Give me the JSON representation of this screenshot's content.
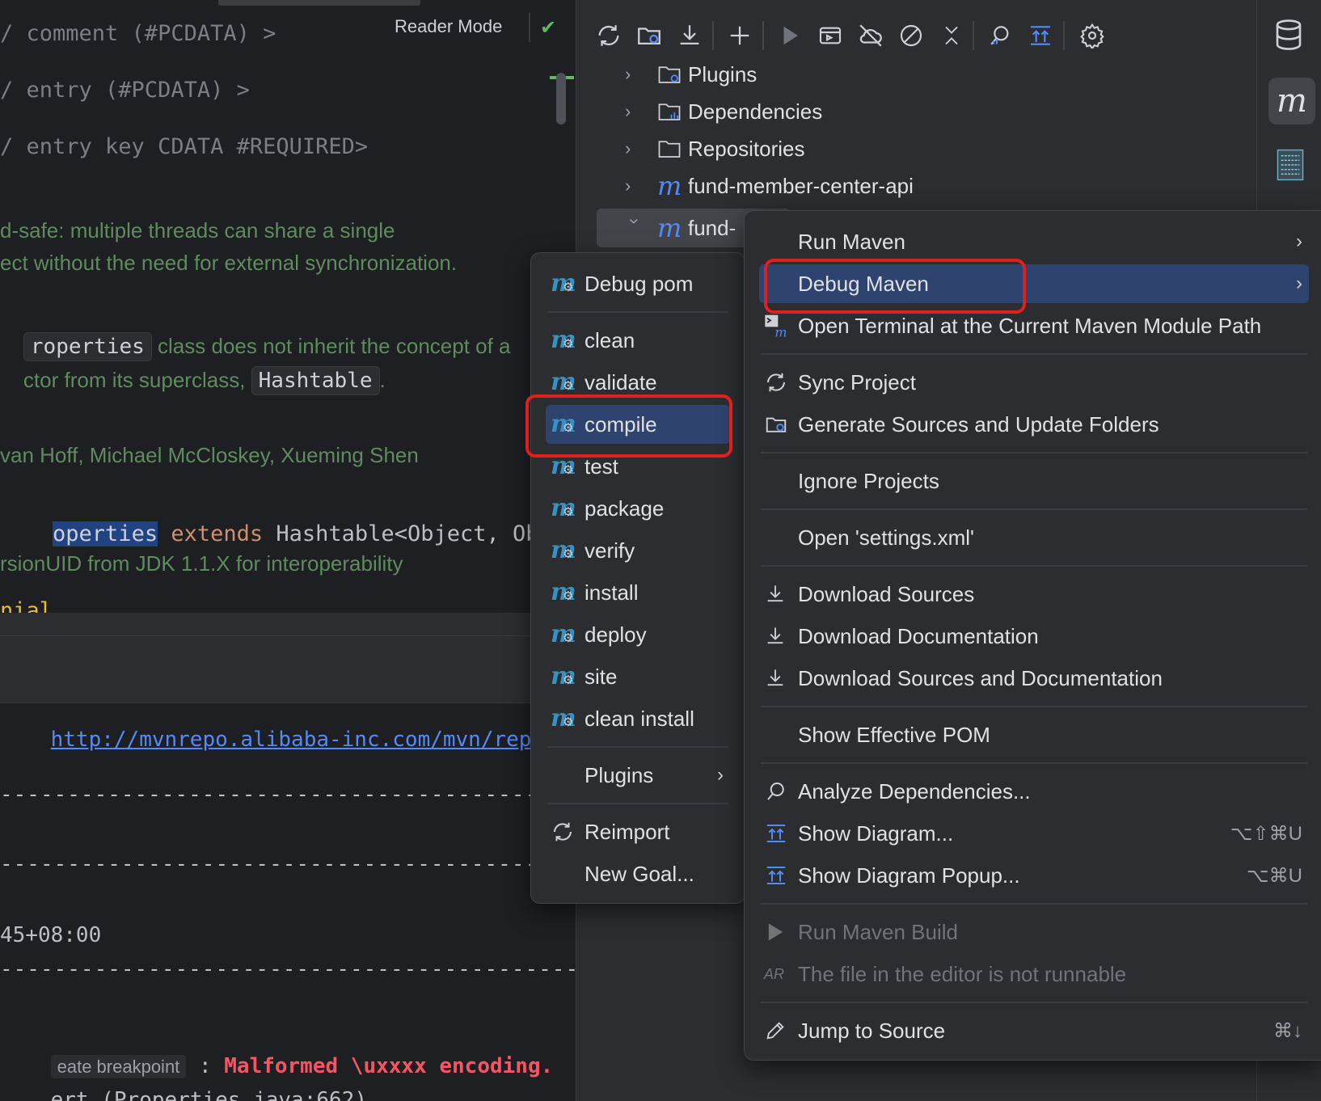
{
  "editor": {
    "reader_mode": "Reader Mode",
    "lines": {
      "l1": "/ comment (#PCDATA) >",
      "l2": "/ entry (#PCDATA) >",
      "l3": "/ entry key CDATA #REQUIRED>",
      "d1": "d-safe: multiple threads can share a single",
      "d2": "ect without the need for external synchronization.",
      "d3_chip": "roperties",
      "d3_rest": " class does not inherit the concept of a",
      "d4_a": "ctor from its superclass, ",
      "d4_chip": "Hashtable",
      "d4_b": ".",
      "d5": "van Hoff, Michael McCloskey, Xueming Shen",
      "c1_sel": "operties",
      "c1_kw": " extends",
      "c1_rest": " Hashtable",
      "c1_gen": "<Object, Object>",
      "d6": "rsionUID from JDK 1.1.X for interoperability",
      "c2": "nial"
    }
  },
  "console": {
    "url_line": "http://mvnrepo.alibaba-inc.com/mvn/reposito",
    "dash": "----------------------------------------------",
    "time": "45+08:00",
    "crumb": "eate breakpoint",
    "colon": " : ",
    "error": "Malformed \\uxxxx encoding.",
    "stack_pre": "ert (",
    "stack_link": "Properties.java:662",
    "stack_post": ")"
  },
  "maven": {
    "toolbar_icons": [
      "sync-icon",
      "folder-refresh-icon",
      "download-icon",
      "add-icon",
      "run-icon",
      "run-config-icon",
      "offline-icon",
      "skip-tests-icon",
      "collapse-icon",
      "analyze-icon",
      "diagram-icon",
      "settings-icon"
    ],
    "tree": [
      {
        "label": "Plugins",
        "icon": "plugins-folder-icon",
        "expanded": false
      },
      {
        "label": "Dependencies",
        "icon": "dependencies-folder-icon",
        "expanded": false
      },
      {
        "label": "Repositories",
        "icon": "repositories-folder-icon",
        "expanded": false
      },
      {
        "label": "fund-member-center-api",
        "icon": "maven-module-icon",
        "expanded": false
      },
      {
        "label": "fund-",
        "icon": "maven-module-icon",
        "expanded": true
      }
    ]
  },
  "strip": {
    "items": [
      "database-icon",
      "maven-icon",
      "binary-icon"
    ]
  },
  "lifecycle_menu": {
    "debug_pom": "Debug pom",
    "goals": [
      "clean",
      "validate",
      "compile",
      "test",
      "package",
      "verify",
      "install",
      "deploy",
      "site",
      "clean install"
    ],
    "plugins": "Plugins",
    "reimport": "Reimport",
    "new_goal": "New Goal..."
  },
  "context_menu": {
    "run_maven": "Run Maven",
    "debug_maven": "Debug Maven",
    "open_terminal": "Open Terminal at the Current Maven Module Path",
    "sync_project": "Sync Project",
    "generate_sources": "Generate Sources and Update Folders",
    "ignore_projects": "Ignore Projects",
    "open_settings": "Open 'settings.xml'",
    "download_sources": "Download Sources",
    "download_docs": "Download Documentation",
    "download_both": "Download Sources and Documentation",
    "show_effective_pom": "Show Effective POM",
    "analyze_deps": "Analyze Dependencies...",
    "show_diagram": "Show Diagram...",
    "show_diagram_shortcut": "⌥⇧⌘U",
    "show_diagram_popup": "Show Diagram Popup...",
    "show_diagram_popup_shortcut": "⌥⌘U",
    "run_build": "Run Maven Build",
    "not_runnable": "The file in the editor is not runnable",
    "jump_to_source": "Jump to Source",
    "jump_shortcut": "⌘↓"
  },
  "colors": {
    "accent": "#548af7",
    "highlight": "#2e436e",
    "annotation": "#e0201d",
    "error": "#f75464"
  }
}
